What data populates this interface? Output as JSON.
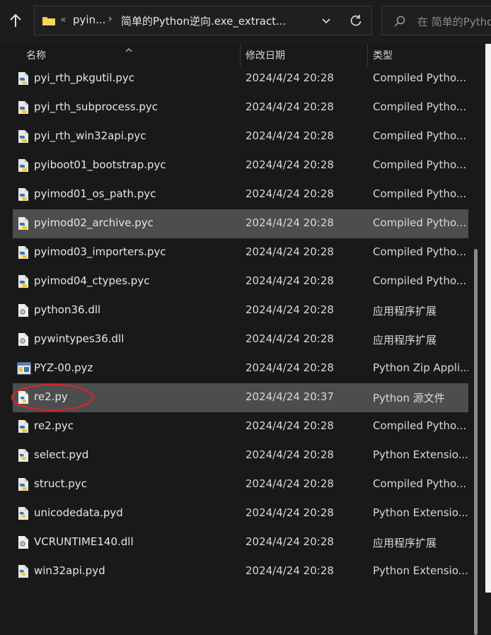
{
  "address_bar": {
    "overflow": "«",
    "crumb1": "pyin...",
    "separator": "›",
    "crumb2": "简单的Python逆向.exe_extract..."
  },
  "search": {
    "placeholder": "在 简单的Python"
  },
  "columns": {
    "name": "名称",
    "date": "修改日期",
    "type": "类型"
  },
  "files": [
    {
      "name": "pyi_rth_pkgutil.pyc",
      "date": "2024/4/24 20:28",
      "type": "Compiled Pytho...",
      "icon": "python-compiled-icon"
    },
    {
      "name": "pyi_rth_subprocess.pyc",
      "date": "2024/4/24 20:28",
      "type": "Compiled Pytho...",
      "icon": "python-compiled-icon"
    },
    {
      "name": "pyi_rth_win32api.pyc",
      "date": "2024/4/24 20:28",
      "type": "Compiled Pytho...",
      "icon": "python-compiled-icon"
    },
    {
      "name": "pyiboot01_bootstrap.pyc",
      "date": "2024/4/24 20:28",
      "type": "Compiled Pytho...",
      "icon": "python-compiled-icon"
    },
    {
      "name": "pyimod01_os_path.pyc",
      "date": "2024/4/24 20:28",
      "type": "Compiled Pytho...",
      "icon": "python-compiled-icon"
    },
    {
      "name": "pyimod02_archive.pyc",
      "date": "2024/4/24 20:28",
      "type": "Compiled Pytho...",
      "icon": "python-compiled-icon",
      "selected": true
    },
    {
      "name": "pyimod03_importers.pyc",
      "date": "2024/4/24 20:28",
      "type": "Compiled Pytho...",
      "icon": "python-compiled-icon"
    },
    {
      "name": "pyimod04_ctypes.pyc",
      "date": "2024/4/24 20:28",
      "type": "Compiled Pytho...",
      "icon": "python-compiled-icon"
    },
    {
      "name": "python36.dll",
      "date": "2024/4/24 20:28",
      "type": "应用程序扩展",
      "icon": "dll-icon"
    },
    {
      "name": "pywintypes36.dll",
      "date": "2024/4/24 20:28",
      "type": "应用程序扩展",
      "icon": "dll-icon"
    },
    {
      "name": "PYZ-00.pyz",
      "date": "2024/4/24 20:28",
      "type": "Python Zip Appli...",
      "icon": "pyz-icon"
    },
    {
      "name": "re2.py",
      "date": "2024/4/24 20:37",
      "type": "Python 源文件",
      "icon": "python-source-icon",
      "selected": true
    },
    {
      "name": "re2.pyc",
      "date": "2024/4/24 20:28",
      "type": "Compiled Pytho...",
      "icon": "python-compiled-icon"
    },
    {
      "name": "select.pyd",
      "date": "2024/4/24 20:28",
      "type": "Python Extensio...",
      "icon": "python-extension-icon"
    },
    {
      "name": "struct.pyc",
      "date": "2024/4/24 20:28",
      "type": "Compiled Pytho...",
      "icon": "python-compiled-icon"
    },
    {
      "name": "unicodedata.pyd",
      "date": "2024/4/24 20:28",
      "type": "Python Extensio...",
      "icon": "python-extension-icon"
    },
    {
      "name": "VCRUNTIME140.dll",
      "date": "2024/4/24 20:28",
      "type": "应用程序扩展",
      "icon": "dll-icon"
    },
    {
      "name": "win32api.pyd",
      "date": "2024/4/24 20:28",
      "type": "Python Extensio...",
      "icon": "python-extension-icon"
    }
  ],
  "colors": {
    "background": "#191919",
    "selected_row": "#4d4d4d",
    "annotation": "#d8242b",
    "folder": "#f0c040"
  }
}
